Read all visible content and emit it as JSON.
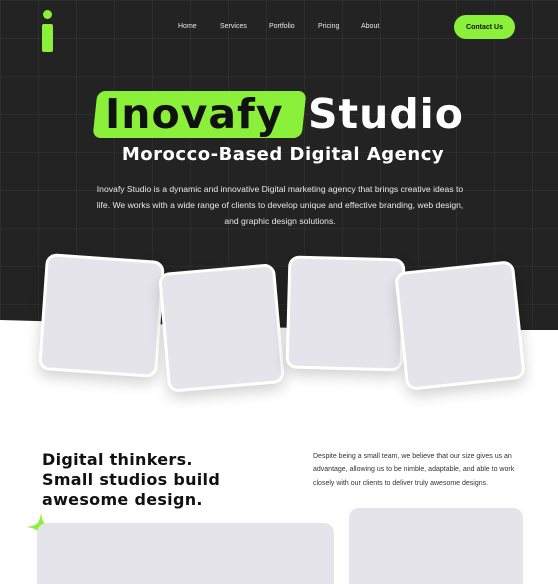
{
  "header": {
    "logo_alt": "i",
    "nav": [
      "Home",
      "Services",
      "Portfolio",
      "Pricing",
      "About"
    ],
    "contact_label": "Contact Us"
  },
  "hero": {
    "title_highlight": "Inovafy",
    "title_rest": "Studio",
    "subtitle": "Morocco-Based Digital Agency",
    "description": "Inovafy Studio is a dynamic and innovative Digital marketing agency that brings creative ideas to life.  We works with a wide range of clients to develop unique and effective branding, web design, and graphic design solutions."
  },
  "about": {
    "headline_lines": [
      "Digital thinkers.",
      "Small studios build",
      "awesome design."
    ],
    "body": "Despite being a small team, we believe that our size gives us an advantage, allowing us to be nimble, adaptable, and able to work closely with our clients to deliver truly awesome designs."
  },
  "colors": {
    "accent": "#8bf03a",
    "dark_bg": "#232323",
    "placeholder": "#e4e4ea"
  }
}
